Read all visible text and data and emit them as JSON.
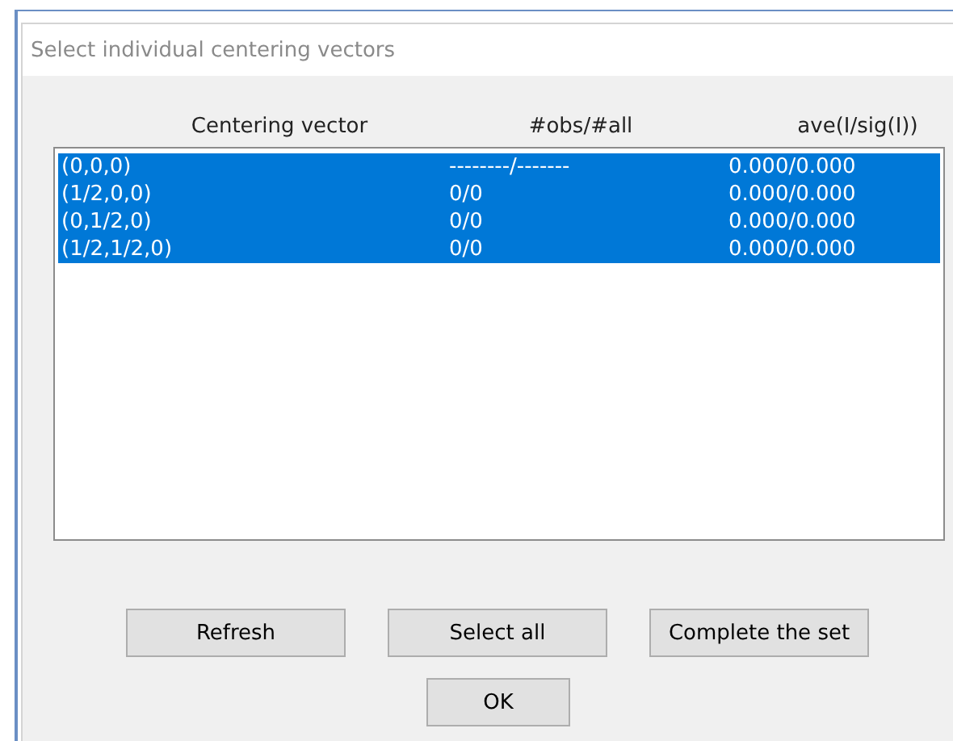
{
  "window": {
    "title": "Select individual centering vectors"
  },
  "table": {
    "columns": [
      "Centering vector",
      "#obs/#all",
      "ave(I/sig(I))"
    ],
    "rows": [
      {
        "cells": [
          "(0,0,0)",
          "--------/-------",
          "0.000/0.000"
        ],
        "selected": true
      },
      {
        "cells": [
          "(1/2,0,0)",
          "0/0",
          "0.000/0.000"
        ],
        "selected": true
      },
      {
        "cells": [
          "(0,1/2,0)",
          "0/0",
          "0.000/0.000"
        ],
        "selected": true
      },
      {
        "cells": [
          "(1/2,1/2,0)",
          "0/0",
          "0.000/0.000"
        ],
        "selected": true
      }
    ]
  },
  "buttons": [
    "Refresh",
    "Select all",
    "Complete the set"
  ],
  "ok_button": "OK"
}
